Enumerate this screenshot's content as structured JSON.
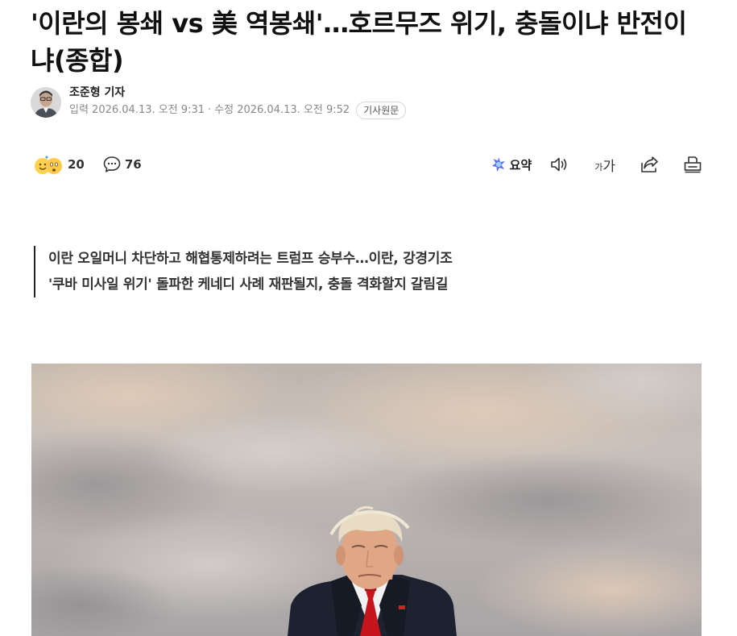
{
  "article": {
    "headline": "'이란의 봉쇄 vs 美 역봉쇄'…호르무즈 위기, 충돌이냐 반전이냐(종합)",
    "reporter": "조준형 기자",
    "published": "입력 2026.04.13. 오전 9:31",
    "separator": "·",
    "modified": "수정 2026.04.13. 오전 9:52",
    "original_button": "기사원문",
    "subheads": [
      "이란 오일머니 차단하고 해협통제하려는 트럼프 승부수…이란, 강경기조",
      "'쿠바 미사일 위기' 돌파한 케네디 사례 재판될지, 충돌 격화할지 갈림길"
    ]
  },
  "toolbar": {
    "reactions_count": "20",
    "comments_count": "76",
    "summary_label": "요약",
    "font_size_small": "가",
    "font_size_large": "가",
    "icons": [
      "emoji-reactions",
      "comment",
      "ai-summary",
      "speaker",
      "font-size",
      "share",
      "print"
    ]
  },
  "colors": {
    "headline": "#111111",
    "meta": "#888888",
    "summary_accent": "#5b6cf0"
  }
}
